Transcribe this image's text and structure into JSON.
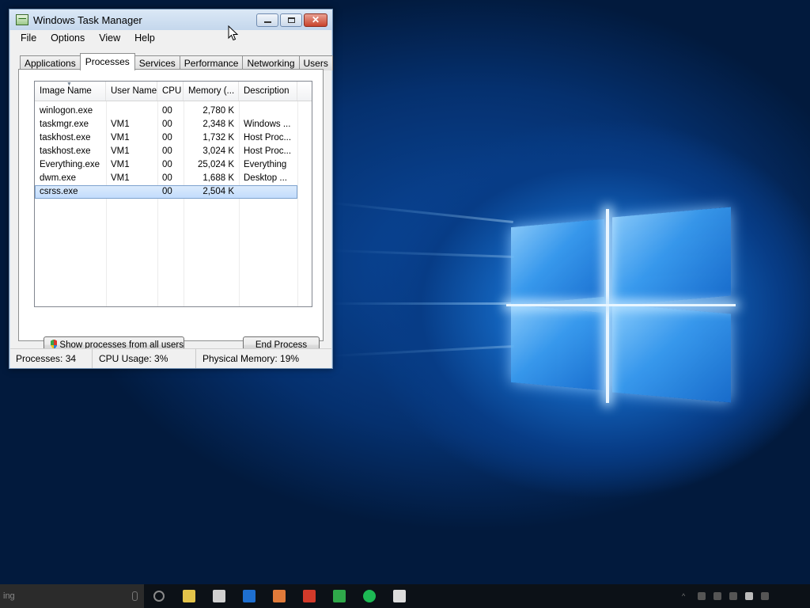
{
  "window": {
    "title": "Windows Task Manager",
    "close_glyph": "✕"
  },
  "menu": [
    "File",
    "Options",
    "View",
    "Help"
  ],
  "tabs": [
    "Applications",
    "Processes",
    "Services",
    "Performance",
    "Networking",
    "Users"
  ],
  "active_tab": "Processes",
  "processes": {
    "columns": [
      "Image Name",
      "User Name",
      "CPU",
      "Memory (...",
      "Description"
    ],
    "rows": [
      {
        "image": "winlogon.exe",
        "user": "",
        "cpu": "00",
        "memory": "2,780 K",
        "description": ""
      },
      {
        "image": "taskmgr.exe",
        "user": "VM1",
        "cpu": "00",
        "memory": "2,348 K",
        "description": "Windows ..."
      },
      {
        "image": "taskhost.exe",
        "user": "VM1",
        "cpu": "00",
        "memory": "1,732 K",
        "description": "Host Proc..."
      },
      {
        "image": "taskhost.exe",
        "user": "VM1",
        "cpu": "00",
        "memory": "3,024 K",
        "description": "Host Proc..."
      },
      {
        "image": "Everything.exe",
        "user": "VM1",
        "cpu": "00",
        "memory": "25,024 K",
        "description": "Everything"
      },
      {
        "image": "dwm.exe",
        "user": "VM1",
        "cpu": "00",
        "memory": "1,688 K",
        "description": "Desktop ..."
      },
      {
        "image": "csrss.exe",
        "user": "",
        "cpu": "00",
        "memory": "2,504 K",
        "description": ""
      }
    ],
    "selected_row": 6
  },
  "buttons": {
    "show_all": "Show processes from all users",
    "end_process": "End Process"
  },
  "status": {
    "processes": "Processes: 34",
    "cpu": "CPU Usage: 3%",
    "memory": "Physical Memory: 19%"
  },
  "taskbar": {
    "search_placeholder": "ing",
    "pinned_icons": [
      {
        "name": "task-view-icon",
        "color": "#8a8a8a"
      },
      {
        "name": "file-explorer-icon",
        "color": "#e3c34a"
      },
      {
        "name": "mail-icon",
        "color": "#d0d0d0"
      },
      {
        "name": "store-icon",
        "color": "#1e6fd0"
      },
      {
        "name": "paint-icon",
        "color": "#e07a3a"
      },
      {
        "name": "red-app-icon",
        "color": "#d23a2a"
      },
      {
        "name": "green-app-icon",
        "color": "#2fa84a"
      },
      {
        "name": "spotify-icon",
        "color": "#1db954"
      },
      {
        "name": "document-icon",
        "color": "#dcdcdc"
      }
    ]
  },
  "colors": {
    "selection": "#c1dbfc",
    "title_gradient_top": "#dbe8f6",
    "close_button": "#c8432b"
  }
}
